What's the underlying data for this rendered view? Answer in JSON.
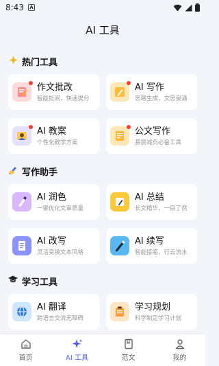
{
  "status_bar": {
    "time": "8:43",
    "sim_label": "A"
  },
  "header": {
    "title": "AI 工具"
  },
  "sections": [
    {
      "title": "热门工具",
      "icon": "sparkle-icon",
      "items": [
        {
          "title": "作文批改",
          "subtitle": "智能批阅，快速提分",
          "icon": "essay-edit-icon",
          "badge": true,
          "bg": "#ffe4e4"
        },
        {
          "title": "AI 写作",
          "subtitle": "思路生成，文思泉涌",
          "icon": "ai-write-icon",
          "badge": true,
          "bg": "#fff0d6"
        },
        {
          "title": "AI 教案",
          "subtitle": "个性化教学方案",
          "icon": "lesson-plan-icon",
          "badge": true,
          "bg": "#e8e4ff"
        },
        {
          "title": "公文写作",
          "subtitle": "基层减负必备工具",
          "icon": "official-doc-icon",
          "badge": true,
          "bg": "#fff0d6"
        }
      ]
    },
    {
      "title": "写作助手",
      "icon": "writing-hand-icon",
      "items": [
        {
          "title": "AI 润色",
          "subtitle": "一键优化文章质量",
          "icon": "polish-icon",
          "badge": false,
          "bg": "#ead8ff"
        },
        {
          "title": "AI 总结",
          "subtitle": "长文精华，一目了然",
          "icon": "summary-icon",
          "badge": false,
          "bg": "#ffd76b"
        },
        {
          "title": "AI 改写",
          "subtitle": "灵活变换文本风格",
          "icon": "rewrite-icon",
          "badge": false,
          "bg": "#c9cdff"
        },
        {
          "title": "AI 续写",
          "subtitle": "智能接笔，行云流水",
          "icon": "continue-write-icon",
          "badge": false,
          "bg": "#b6e6ff"
        }
      ]
    },
    {
      "title": "学习工具",
      "icon": "graduation-cap-icon",
      "items": [
        {
          "title": "AI 翻译",
          "subtitle": "跨语言交流无障碍",
          "icon": "translate-globe-icon",
          "badge": false,
          "bg": "#cfe8ff"
        },
        {
          "title": "学习规划",
          "subtitle": "科学制定学习计划",
          "icon": "study-plan-icon",
          "badge": false,
          "bg": "#ffe6c4"
        },
        {
          "title": "",
          "subtitle": "",
          "icon": "cut-off-item-icon",
          "badge": false,
          "bg": "#ffe7a8"
        },
        {
          "title": "",
          "subtitle": "",
          "icon": "cut-off-item-icon",
          "badge": false,
          "bg": "#ffe7a8"
        }
      ]
    }
  ],
  "tabbar": [
    {
      "label": "首页",
      "icon": "home-icon",
      "active": false
    },
    {
      "label": "AI 工具",
      "icon": "sparkles-icon",
      "active": true
    },
    {
      "label": "范文",
      "icon": "book-icon",
      "active": false
    },
    {
      "label": "我的",
      "icon": "user-icon",
      "active": false
    }
  ],
  "colors": {
    "accent": "#4d5cf5",
    "badge": "#ff3b30",
    "background": "#f4f4fb"
  }
}
